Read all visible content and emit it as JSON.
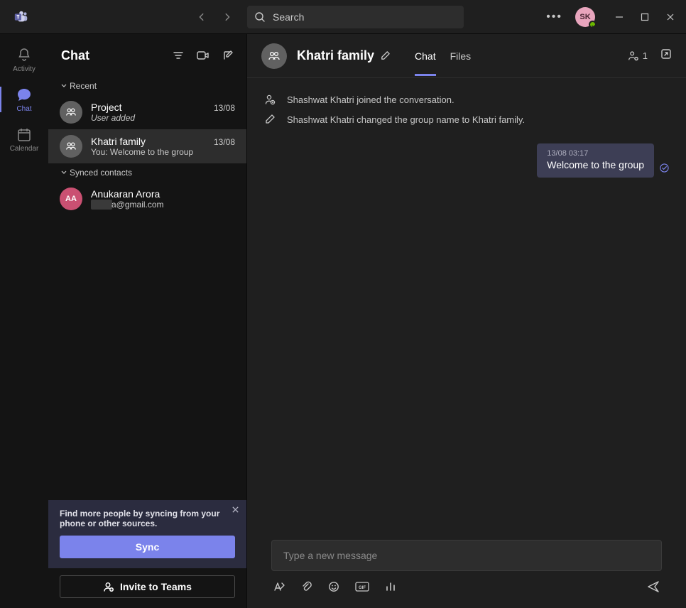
{
  "titlebar": {
    "search_placeholder": "Search",
    "avatar_initials": "SK"
  },
  "rail": {
    "items": [
      {
        "label": "Activity"
      },
      {
        "label": "Chat"
      },
      {
        "label": "Calendar"
      }
    ]
  },
  "panel": {
    "title": "Chat",
    "section_recent": "Recent",
    "section_synced": "Synced contacts",
    "chats": [
      {
        "name": "Project",
        "date": "13/08",
        "preview": "User added"
      },
      {
        "name": "Khatri family",
        "date": "13/08",
        "preview": "You: Welcome to the group"
      }
    ],
    "contacts": [
      {
        "name": "Anukaran Arora",
        "initials": "AA",
        "detail_suffix": "a@gmail.com"
      }
    ],
    "sync_card": {
      "text": "Find more people by syncing from your phone or other sources.",
      "button": "Sync"
    },
    "invite_button": "Invite to Teams"
  },
  "conversation": {
    "title": "Khatri family",
    "tabs": [
      {
        "label": "Chat"
      },
      {
        "label": "Files"
      }
    ],
    "participants_count": "1",
    "system_messages": [
      "Shashwat Khatri joined the conversation.",
      "Shashwat Khatri changed the group name to Khatri family."
    ],
    "messages": [
      {
        "time": "13/08 03:17",
        "text": "Welcome to the group"
      }
    ],
    "composer_placeholder": "Type a new message"
  }
}
